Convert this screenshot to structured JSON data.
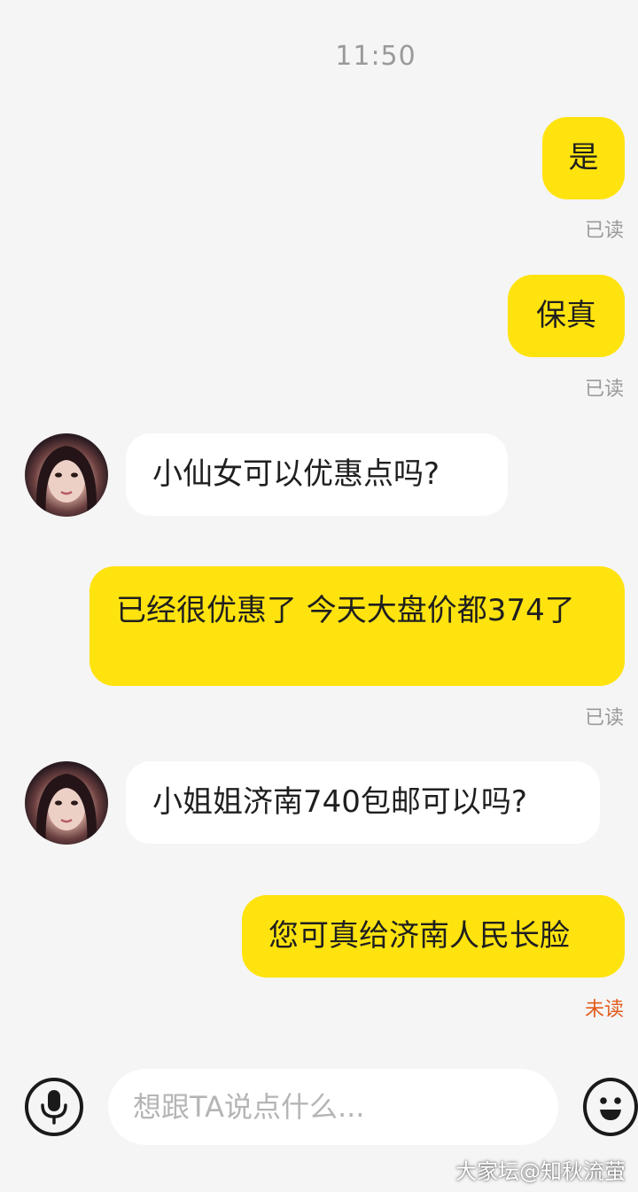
{
  "status": {
    "time": "11:50"
  },
  "messages": [
    {
      "side": "out",
      "text": "是",
      "status": "已读"
    },
    {
      "side": "out",
      "text": "保真",
      "status": "已读"
    },
    {
      "side": "in",
      "text": "小仙女可以优惠点吗?"
    },
    {
      "side": "out",
      "text": "已经很优惠了 今天大盘价都374了",
      "status": "已读"
    },
    {
      "side": "in",
      "text": "小姐姐济南740包邮可以吗?"
    },
    {
      "side": "out",
      "text": "您可真给济南人民长脸",
      "status": "未读"
    }
  ],
  "composer": {
    "placeholder": "想跟TA说点什么..."
  },
  "watermark": "大家坛@知秋流萤",
  "colors": {
    "outgoing_bubble": "#ffe30f",
    "incoming_bubble": "#ffffff",
    "unread_status": "#e25c1d",
    "read_status": "#9a9a9a"
  },
  "icons": {
    "voice": "microphone-icon",
    "emoji": "smiley-icon"
  }
}
